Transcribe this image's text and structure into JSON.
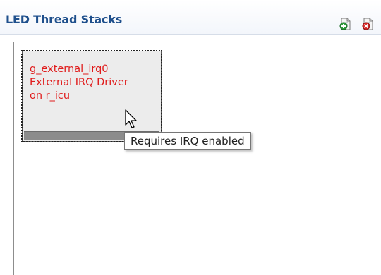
{
  "panel": {
    "title": "LED Thread Stacks",
    "toolbar": [
      {
        "name": "add-thread-stack",
        "icon": "add-document-icon"
      },
      {
        "name": "remove-thread-stack",
        "icon": "remove-document-icon"
      }
    ]
  },
  "thread_stack": {
    "line1": "g_external_irq0",
    "line2": "External IRQ Driver",
    "line3": "on r_icu",
    "text_color": "#e01b1b"
  },
  "tooltip": {
    "text": "Requires IRQ enabled"
  },
  "colors": {
    "title": "#1e4f8c",
    "error_text": "#e01b1b"
  }
}
